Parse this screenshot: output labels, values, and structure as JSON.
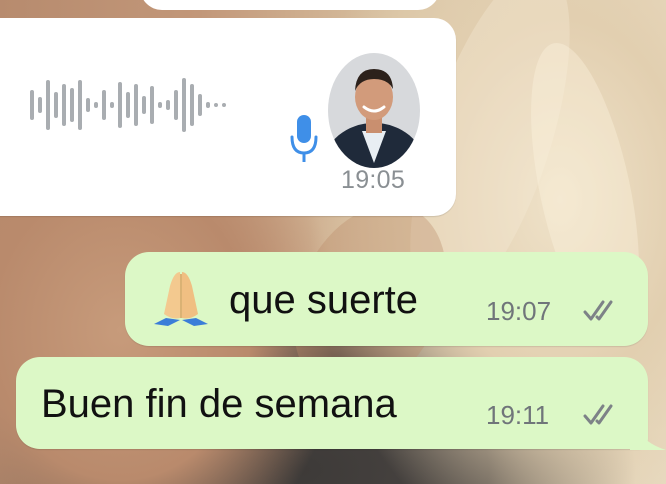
{
  "chat": {
    "voice_message": {
      "time": "19:05",
      "status_icon": "mic-icon",
      "sender_avatar": "avatar"
    },
    "messages": [
      {
        "emoji_icon": "praying-hands-icon",
        "text": "que suerte",
        "time": "19:07",
        "status_icon": "double-check-icon"
      },
      {
        "text": "Buen fin de semana",
        "time": "19:11",
        "status_icon": "double-check-icon"
      }
    ]
  },
  "colors": {
    "outgoing_bubble": "#dcf8c6",
    "incoming_bubble": "#ffffff",
    "mic_accent": "#3f8fe8",
    "timestamp": "#70757a"
  }
}
